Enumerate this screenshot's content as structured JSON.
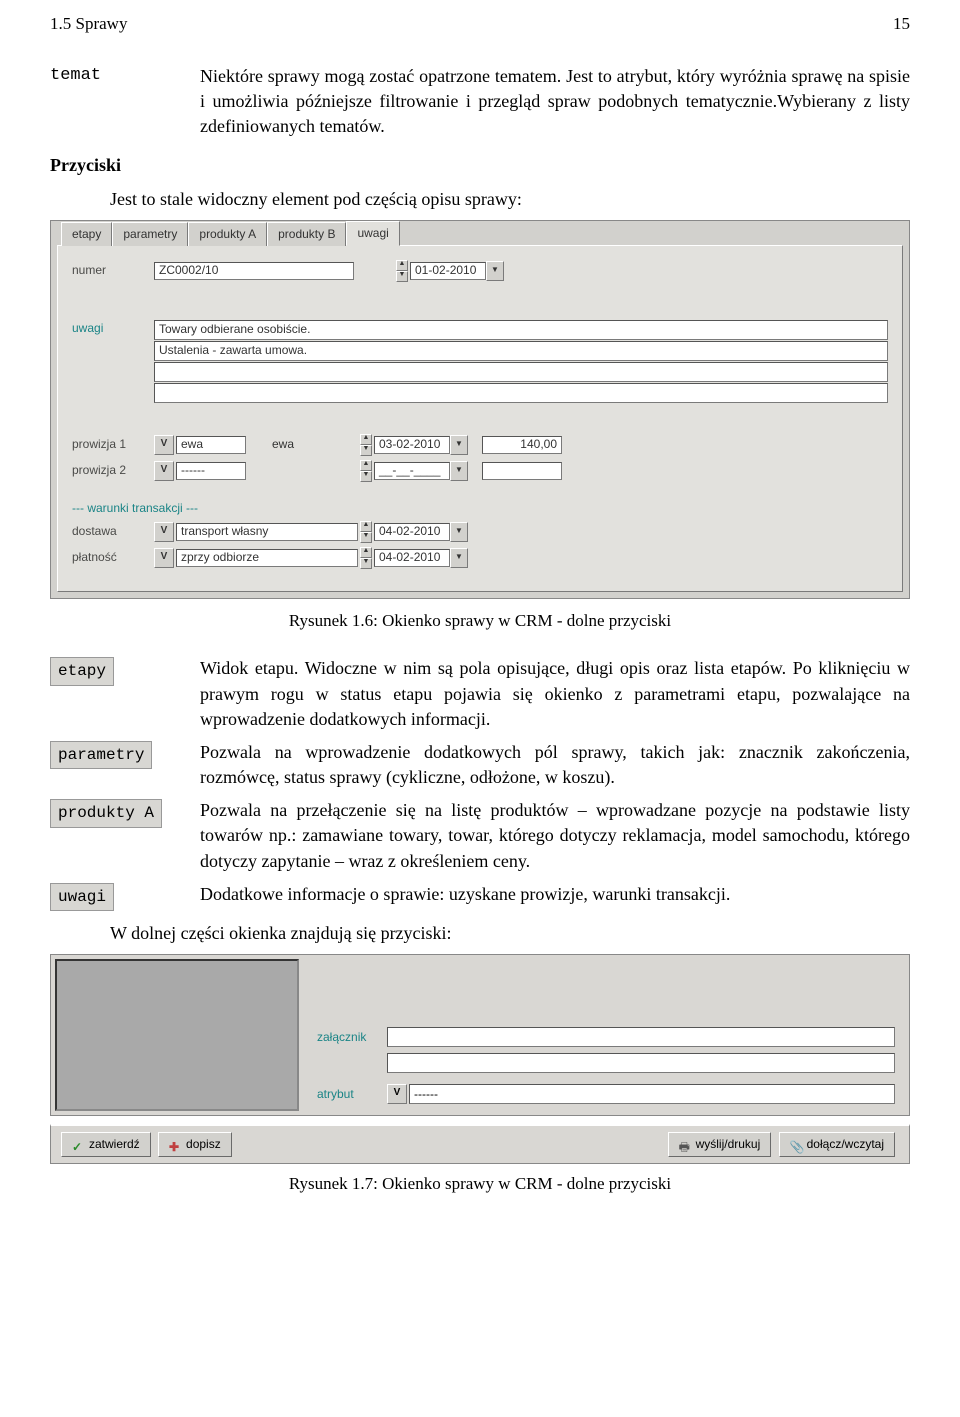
{
  "header": {
    "left": "1.5 Sprawy",
    "right": "15"
  },
  "def_temat": {
    "term": "temat",
    "text": "Niektóre sprawy mogą zostać opatrzone tematem. Jest to atrybut, który wyróżnia sprawę na spisie i umożliwia późniejsze filtrowanie i przegląd spraw podobnych tematycznie.Wybierany z listy zdefiniowanych tematów."
  },
  "przyciski_head": "Przyciski",
  "przyciski_sub": "Jest to stale widoczny element pod częścią opisu sprawy:",
  "form1": {
    "tabs": [
      "etapy",
      "parametry",
      "produkty A",
      "produkty B",
      "uwagi"
    ],
    "active_tab": 4,
    "numer_label": "numer",
    "numer_value": "ZC0002/10",
    "numer_date": "01-02-2010",
    "uwagi_label": "uwagi",
    "uwagi_lines": [
      "Towary odbierane osobiście.",
      "Ustalenia - zawarta umowa.",
      "",
      ""
    ],
    "prow1_label": "prowizja 1",
    "prow1_sel1": "ewa",
    "prow1_sel2": "ewa",
    "prow1_date": "03-02-2010",
    "prow1_amt": "140,00",
    "prow2_label": "prowizja 2",
    "prow2_sel": "------",
    "prow2_date": "__-__-____",
    "warunki_label": "--- warunki transakcji ---",
    "dostawa_label": "dostawa",
    "dostawa_val": "transport własny",
    "dostawa_date": "04-02-2010",
    "platnosc_label": "płatność",
    "platnosc_val": "zprzy odbiorze",
    "platnosc_date": "04-02-2010"
  },
  "caption1": "Rysunek 1.6: Okienko sprawy w CRM - dolne przyciski",
  "buttons": [
    {
      "label": "etapy",
      "text": "Widok etapu. Widoczne w nim są pola opisujące, długi opis oraz lista etapów. Po kliknięciu w prawym rogu w status etapu pojawia się okienko z parametrami etapu, pozwalające na wprowadzenie dodatkowych informacji."
    },
    {
      "label": "parametry",
      "text": "Pozwala na wprowadzenie dodatkowych pól sprawy, takich jak: znacznik zakończenia, rozmówcę, status sprawy (cykliczne, odłożone, w koszu)."
    },
    {
      "label": "produkty A",
      "text": "Pozwala na przełączenie się na listę produktów – wprowadzane pozycje na podstawie listy towarów np.: zamawiane towary, towar, którego dotyczy reklamacja, model samochodu, którego dotyczy zapytanie – wraz z określeniem ceny."
    },
    {
      "label": "uwagi",
      "text": "Dodatkowe informacje o sprawie: uzyskane prowizje, warunki transakcji."
    }
  ],
  "bottom_text": "W dolnej części okienka znajdują się przyciski:",
  "panel2": {
    "zalacznik": "załącznik",
    "atrybut": "atrybut",
    "atrybut_val": "------"
  },
  "bbar": {
    "zatwierdz": "zatwierdź",
    "dopisz": "dopisz",
    "wyslij": "wyślij/drukuj",
    "dolacz": "dołącz/wczytaj"
  },
  "caption2": "Rysunek 1.7: Okienko sprawy w CRM - dolne przyciski"
}
